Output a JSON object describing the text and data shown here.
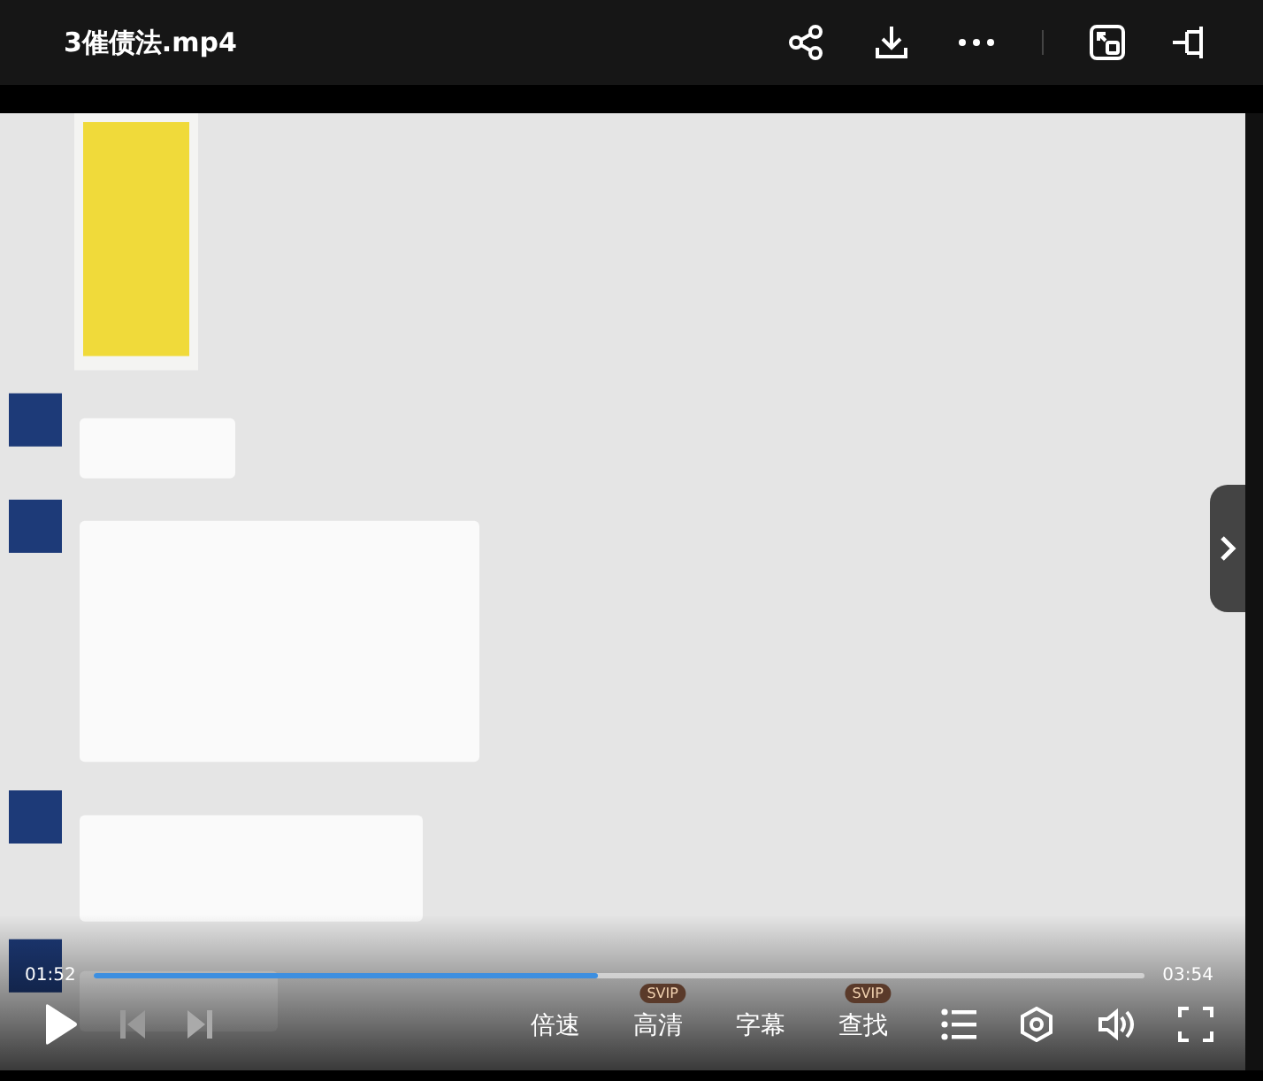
{
  "window": {
    "title": "3催债法.mp4"
  },
  "player": {
    "elapsed": "01:52",
    "duration": "03:54",
    "level": 0.48,
    "playing": false,
    "options": [
      {
        "label": "倍速"
      },
      {
        "label": "高清",
        "badge": "SVIP"
      },
      {
        "label": "字幕"
      },
      {
        "label": "查找",
        "badge": "SVIP"
      }
    ]
  }
}
